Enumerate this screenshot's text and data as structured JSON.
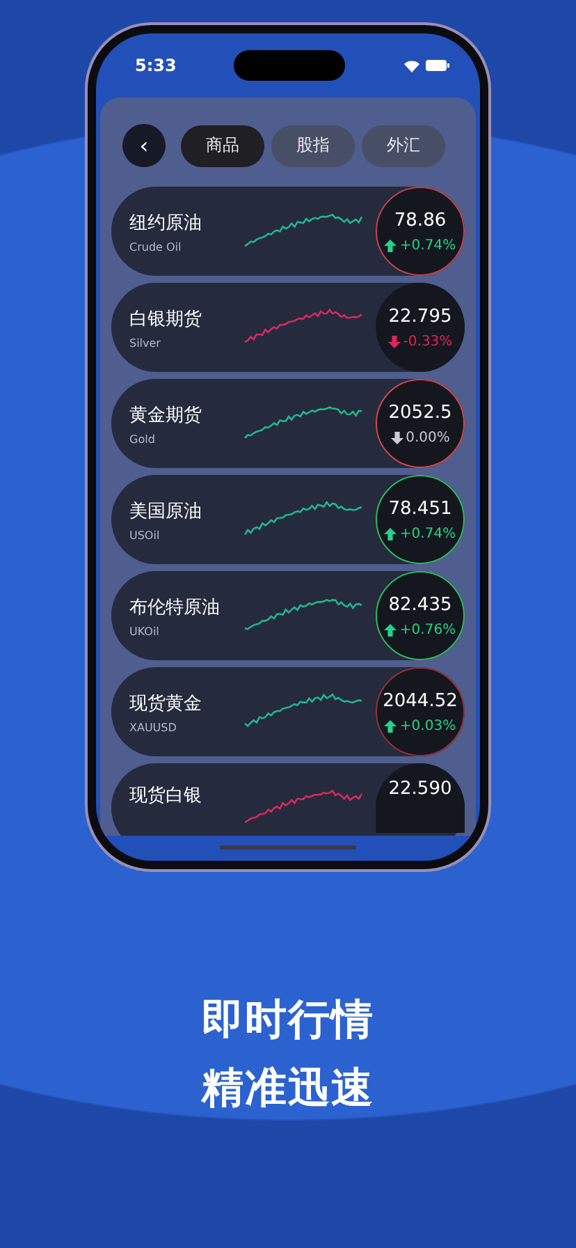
{
  "status_bar": {
    "time": "5:33"
  },
  "back_button": {
    "label": "‹"
  },
  "tabs": [
    {
      "label": "商品",
      "selected": true
    },
    {
      "label": "股指",
      "selected": false
    },
    {
      "label": "外汇",
      "selected": false
    }
  ],
  "quotes": [
    {
      "name": "纽约原油",
      "code": "Crude Oil",
      "color": "#22b58c",
      "price": "78.86",
      "kind": "up",
      "change": "+0.74%",
      "ring": {
        "color": "#c2404a"
      }
    },
    {
      "name": "白银期货",
      "code": "Silver",
      "color": "#d42a5c",
      "price": "22.795",
      "kind": "down",
      "change": "-0.33%"
    },
    {
      "name": "黄金期货",
      "code": "Gold",
      "color": "#22b58c",
      "price": "2052.5",
      "kind": "flat",
      "change": "0.00%",
      "ring": {
        "color": "#d0454c"
      }
    },
    {
      "name": "美国原油",
      "code": "USOil",
      "color": "#22b58c",
      "price": "78.451",
      "kind": "up",
      "change": "+0.74%",
      "ring": {
        "color": "#2fb860"
      }
    },
    {
      "name": "布伦特原油",
      "code": "UKOil",
      "color": "#22b58c",
      "price": "82.435",
      "kind": "up",
      "change": "+0.76%",
      "ring": {
        "color": "#2fb860"
      }
    },
    {
      "name": "现货黄金",
      "code": "XAUUSD",
      "color": "#22b58c",
      "price": "2044.52",
      "kind": "up",
      "change": "+0.03%",
      "ring": {
        "color": "#8e3238"
      }
    },
    {
      "name": "现货白银",
      "color": "#d42a5c",
      "price": "22.590"
    }
  ],
  "headline": [
    "即时行情",
    "精准迅速"
  ]
}
